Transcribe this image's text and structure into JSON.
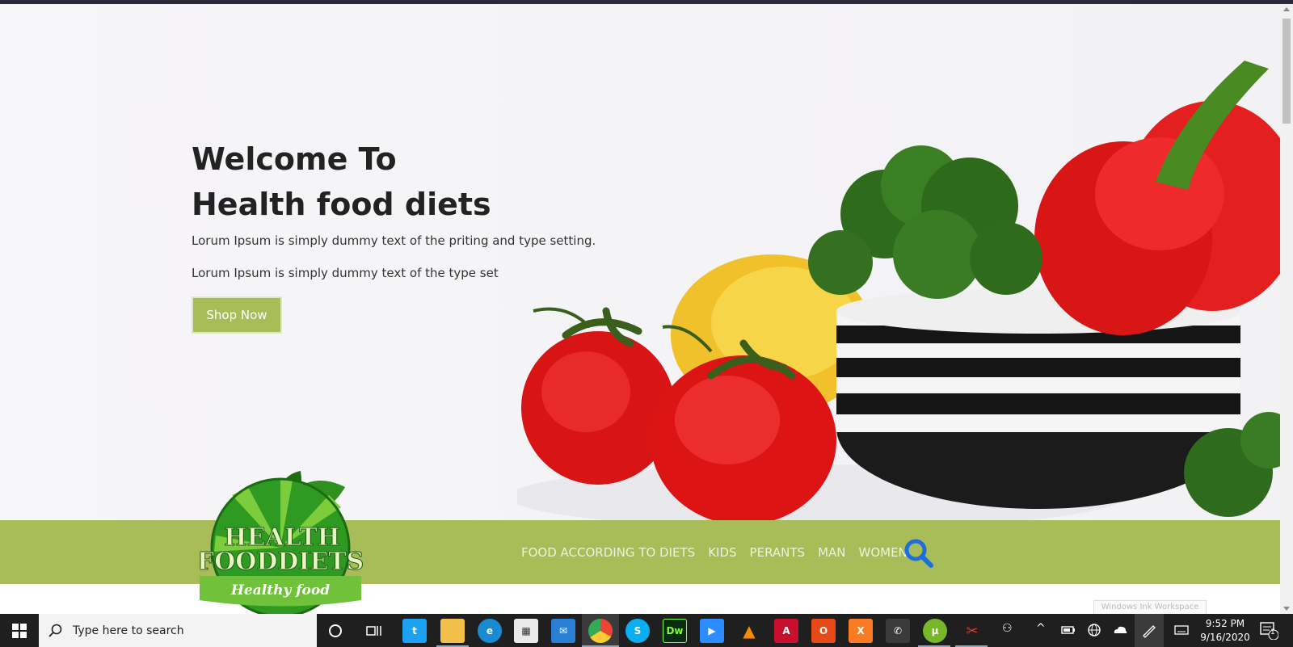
{
  "hero": {
    "title_line1": "Welcome To",
    "title_line2": "Health food diets",
    "subtitle1": "Lorum Ipsum is simply dummy text of the priting and type setting.",
    "subtitle2": "Lorum Ipsum is simply dummy text of the type set",
    "cta_label": "Shop Now"
  },
  "nav": {
    "items": [
      "FOOD ACCORDING TO DIETS",
      "KIDS",
      "PERANTS",
      "MAN",
      "WOMEN"
    ],
    "search_icon": "search-icon"
  },
  "logo": {
    "line1": "HEALTH",
    "line2": "FOODDIETS",
    "tagline": "Healthy food"
  },
  "overlay": {
    "ink_workspace": "Windows Ink Workspace"
  },
  "taskbar": {
    "search_placeholder": "Type here to search",
    "apps": [
      "cortana",
      "task-view",
      "twitter",
      "file-explorer",
      "edge",
      "store",
      "mail",
      "chrome",
      "skype",
      "dreamweaver",
      "zoom",
      "vlc",
      "acrobat",
      "office",
      "xampp",
      "whatsapp",
      "utorrent",
      "snipping-tool"
    ],
    "time": "9:52 PM",
    "date": "9/16/2020",
    "notification_count": "1"
  },
  "colors": {
    "accent": "#a8bc58",
    "nav_text": "#eef2dd",
    "search_icon": "#1e6fd9",
    "taskbar": "#1f1f1f"
  }
}
